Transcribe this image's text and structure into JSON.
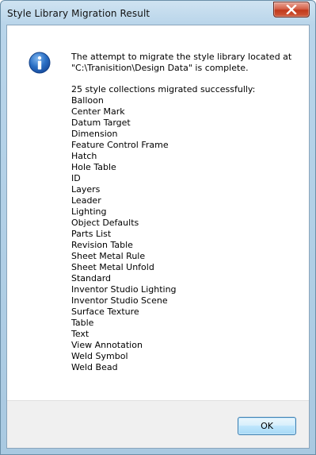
{
  "window": {
    "title": "Style Library Migration Result"
  },
  "message": {
    "line1": "The attempt to migrate the style library located at",
    "line2": "\"C:\\Tranisition\\Design Data\" is complete.",
    "summary": "25 style collections migrated successfully:",
    "collections": [
      "Balloon",
      "Center Mark",
      "Datum Target",
      "Dimension",
      "Feature Control Frame",
      "Hatch",
      "Hole Table",
      "ID",
      "Layers",
      "Leader",
      "Lighting",
      "Object Defaults",
      "Parts List",
      "Revision Table",
      "Sheet Metal Rule",
      "Sheet Metal Unfold",
      "Standard",
      "Inventor Studio Lighting",
      "Inventor Studio Scene",
      "Surface Texture",
      "Table",
      "Text",
      "View Annotation",
      "Weld Symbol",
      "Weld Bead"
    ]
  },
  "buttons": {
    "ok_label": "OK"
  },
  "icons": {
    "info": "info-icon",
    "close": "close-icon"
  },
  "colors": {
    "info_blue": "#1f63b5",
    "close_red": "#c1391c",
    "frame_blue": "#b9d5ea"
  }
}
